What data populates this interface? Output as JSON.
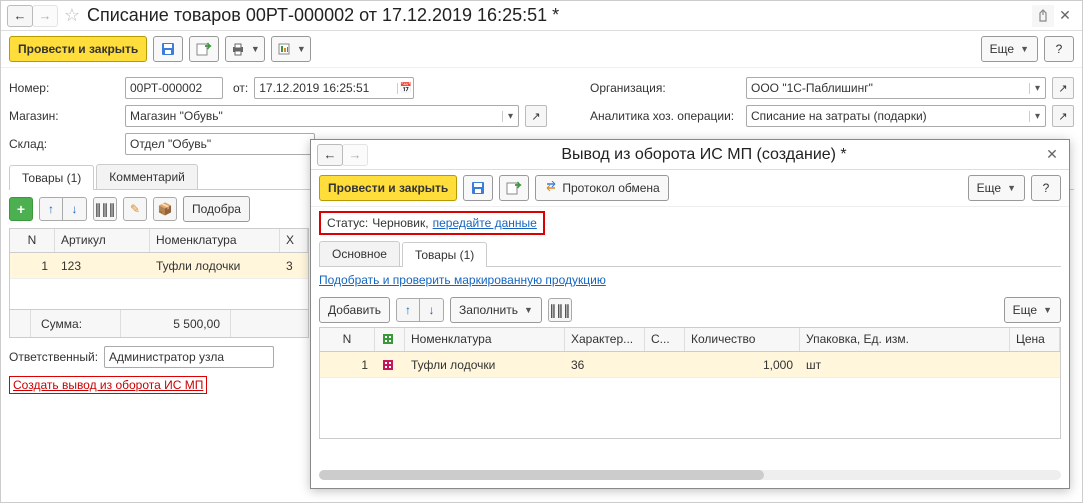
{
  "main": {
    "title": "Списание товаров 00РТ-000002 от 17.12.2019 16:25:51 *",
    "post_and_close": "Провести и закрыть",
    "more": "Еще",
    "labels": {
      "number": "Номер:",
      "from": "от:",
      "org": "Организация:",
      "shop": "Магазин:",
      "analytics": "Аналитика хоз. операции:",
      "warehouse": "Склад:"
    },
    "values": {
      "number": "00РТ-000002",
      "date": "17.12.2019 16:25:51",
      "org": "ООО \"1С-Паблишинг\"",
      "shop": "Магазин \"Обувь\"",
      "analytics": "Списание на затраты (подарки)",
      "warehouse": "Отдел \"Обувь\""
    },
    "tabs": {
      "goods": "Товары (1)",
      "comment": "Комментарий"
    },
    "item_toolbar": {
      "select": "Подобра"
    },
    "grid": {
      "cols": {
        "n": "N",
        "art": "Артикул",
        "nomen": "Номенклатура",
        "x": "Х"
      },
      "rows": [
        {
          "n": "1",
          "art": "123",
          "nomen": "Туфли лодочки",
          "x": "3"
        }
      ]
    },
    "total": {
      "label": "Сумма:",
      "value": "5 500,00"
    },
    "responsible": {
      "label": "Ответственный:",
      "value": "Администратор узла"
    },
    "create_link": "Создать вывод из оборота ИС МП"
  },
  "sub": {
    "title": "Вывод из оборота ИС МП (создание) *",
    "post_and_close": "Провести и закрыть",
    "exchange_log": "Протокол обмена",
    "more": "Еще",
    "status_label": "Статус:",
    "status_value": "Черновик,",
    "status_link": "передайте данные",
    "tabs": {
      "main": "Основное",
      "goods": "Товары (1)"
    },
    "pick_link": "Подобрать и проверить маркированную продукцию",
    "item_toolbar": {
      "add": "Добавить",
      "fill": "Заполнить"
    },
    "grid": {
      "cols": {
        "n": "N",
        "mark": "",
        "nomen": "Номенклатура",
        "char": "Характер...",
        "s": "С...",
        "qty": "Количество",
        "pack": "Упаковка, Ед. изм.",
        "price": "Цена"
      },
      "rows": [
        {
          "n": "1",
          "nomen": "Туфли лодочки",
          "char": "36",
          "s": "",
          "qty": "1,000",
          "pack": "шт",
          "price": ""
        }
      ]
    }
  }
}
